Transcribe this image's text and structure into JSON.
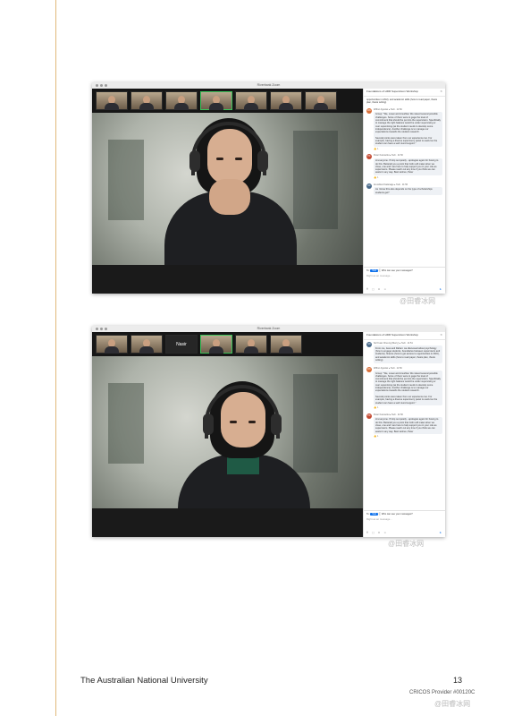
{
  "shot1": {
    "window_title": "Riverbank Zoom",
    "chat_title": "Foundations of HDR Supervision Workshop",
    "messages": [
      {
        "initials": "",
        "sender": "",
        "text": "opportunities in ANU), and academic skills (how to read paper, thesis plan, thesis writing)"
      },
      {
        "initials": "WA",
        "sender": "Wilbur Agustar ▸ Tedi · 11:50",
        "text": "Group: \"We, Luwei and Anushka: We raised several possible challenges. Some of them were to gage the level of commitment that should be put into the supervision. Specifically to manage the right balance would be under supervising or over supervising (as the student needs to develop some independence). Another challenge is to manage our expectations towards the student research.\n\nSeveral points were taken from our experience too. For example, having a diverse supervisory panel is useful so the student can have a well round support.\"",
        "react": "👍 1"
      },
      {
        "initials": "PK",
        "sender": "Peter Kanowski ▸ Tedi · 11:50",
        "text": "Hi everyone. I'll slip out quietly - apologies again for having to do this. Betterall you a point that Colin will make when we close, one and I are here to help support you in your role as supervisors. Please reach out any time if you think we can assist in any way. Best wishes, Peter",
        "react": "👍 1"
      },
      {
        "initials": "AC",
        "sender": "Anushka Chalanage ▸ Tedi · 11:56",
        "text": "As I know this also depends on the type of scholarships students get?",
        "react": ""
      }
    ],
    "to_label": "Tedi",
    "to_note": "Ⓘ Who can see your messages?",
    "placeholder": "Right as an message..."
  },
  "shot2": {
    "window_title": "Riverbank Zoom",
    "chat_title": "Foundations of HDR Supervision Workshop",
    "tile_name": "Nasir",
    "messages": [
      {
        "initials": "SN",
        "sender": "Sol Kuan Cheung (Merry) ▸ Tedi · 11:51",
        "text": "From me, Jess and Rahan: we discussed about psychology (how to engage students, boundaries between supervisors and students), finance (how to get access to opportunities in ANU), and academic skills (how to read paper, thesis plan, thesis writing)",
        "react": ""
      },
      {
        "initials": "WA",
        "sender": "Wilbur Agustar ▸ Tedi · 11:50",
        "text": "Group: \"We, Luwei and Anushka: We raised several possible challenges. Some of them were to gage the level of commitment that should be put into the supervision. Specifically to manage the right balance would be under supervising or over supervising (as the student needs to develop some independence). Another challenge is to manage our expectations towards the student research.\n\nSeveral points were taken from our experience too. For example, having a diverse supervisory panel is useful so the student can have a well round support.\"",
        "react": "👍 1"
      },
      {
        "initials": "PK",
        "sender": "Peter Kanowski ▸ Tedi · 11:50",
        "text": "Hi everyone. I'll slip out quietly - apologies again for having to do this. Betterall you a point that Colin will make when we close, one and I are here to help support you in your role as supervisors. Please reach out any time if you think we can assist in any way. Best wishes, Peter",
        "react": "👍 1"
      }
    ],
    "to_label": "Tedi",
    "to_note": "Ⓘ Who can see your messages?",
    "placeholder": "Right as an message..."
  },
  "watermarks": [
    "@田睿冰网",
    "@田睿冰网",
    "@田睿冰网"
  ],
  "footer": {
    "university": "The Australian National University",
    "page_number": "13",
    "cricos": "CRICOS Provider #00120C"
  }
}
